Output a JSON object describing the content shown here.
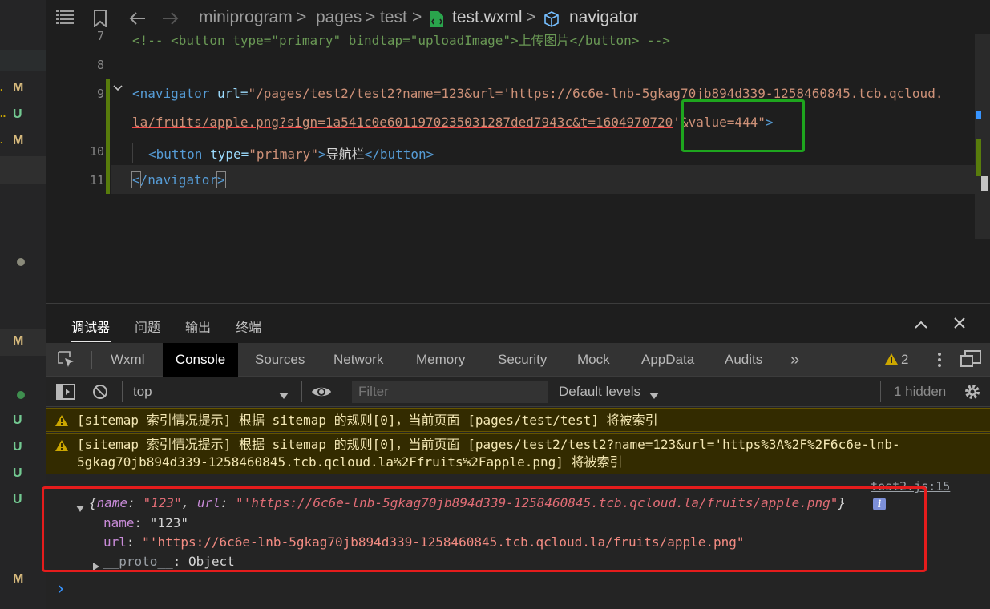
{
  "breadcrumb": {
    "segments": [
      "miniprogram",
      "pages",
      "test"
    ],
    "file": "test.wxml",
    "symbol": "navigator",
    "sep": ">"
  },
  "editor": {
    "lines": [
      {
        "num": "7",
        "comment": "<!-- <button type=\"primary\" bindtap=\"uploadImage\">上传图片</button> -->"
      },
      {
        "num": "8"
      },
      {
        "num": "9",
        "tag_open": "<navigator",
        "attr_url": "url=",
        "q1": "\"/pages/test2/test2?name=123&url='",
        "link1": "https://6c6e-lnb-5gkag70jb894d339-1258460845.tcb.qcloud.",
        "link2": "la/fruits/apple.png?sign=1a541c0e6011970235031287ded7943c&t=1604970720",
        "q2": "'&value=444\"",
        "close": ">"
      },
      {
        "num": "10",
        "open": "<button",
        "attr": "type=",
        "val": "\"primary\"",
        "gt": ">",
        "text": "导航栏",
        "end": "</button>"
      },
      {
        "num": "11",
        "lt": "<",
        "rest": "/navigator",
        "gt": ">"
      }
    ]
  },
  "panel": {
    "tabs": [
      "调试器",
      "问题",
      "输出",
      "终端"
    ],
    "devtools_tabs": [
      "Wxml",
      "Console",
      "Sources",
      "Network",
      "Memory",
      "Security",
      "Mock",
      "AppData",
      "Audits"
    ],
    "active_devtools_tab": "Console",
    "warning_count": "2",
    "more": "»",
    "toolbar": {
      "context": "top",
      "filter_placeholder": "Filter",
      "levels": "Default levels",
      "hidden": "1 hidden"
    }
  },
  "console": {
    "warnings": [
      {
        "line1": "[sitemap 索引情况提示] 根据 sitemap 的规则[0]，当前页面 [pages/test/test] 将被索引"
      },
      {
        "line1": "[sitemap 索引情况提示] 根据 sitemap 的规则[0]，当前页面 [pages/test2/test2?name=123&url='https%3A%2F%2F6c6e-lnb-",
        "line2": "5gkag70jb894d339-1258460845.tcb.qcloud.la%2Ffruits%2Fapple.png] 将被索引"
      }
    ],
    "source_link": "test2.js:15",
    "object": {
      "summary_open": "{",
      "name_key": "name",
      "name_val": "\"123\"",
      "comma": ", ",
      "url_key": "url",
      "url_val": "\"'https://6c6e-lnb-5gkag70jb894d339-1258460845.tcb.qcloud.la/fruits/apple.png\"",
      "summary_close": "}",
      "info_badge": "i",
      "prop_name_key": "name",
      "prop_name_val": "\"123\"",
      "prop_url_key": "url",
      "prop_url_val": "\"'https://6c6e-lnb-5gkag70jb894d339-1258460845.tcb.qcloud.la/fruits/apple.png\"",
      "proto_key": "__proto__",
      "proto_val": "Object",
      "colon": ": "
    },
    "prompt": "›"
  },
  "scm_badges": {
    "m": "M",
    "u": "U",
    "dots": "..",
    "dot1": "."
  },
  "colors": {
    "highlight_green": "#1ea51e",
    "highlight_red": "#e51c1c",
    "warning": "#cca700"
  }
}
